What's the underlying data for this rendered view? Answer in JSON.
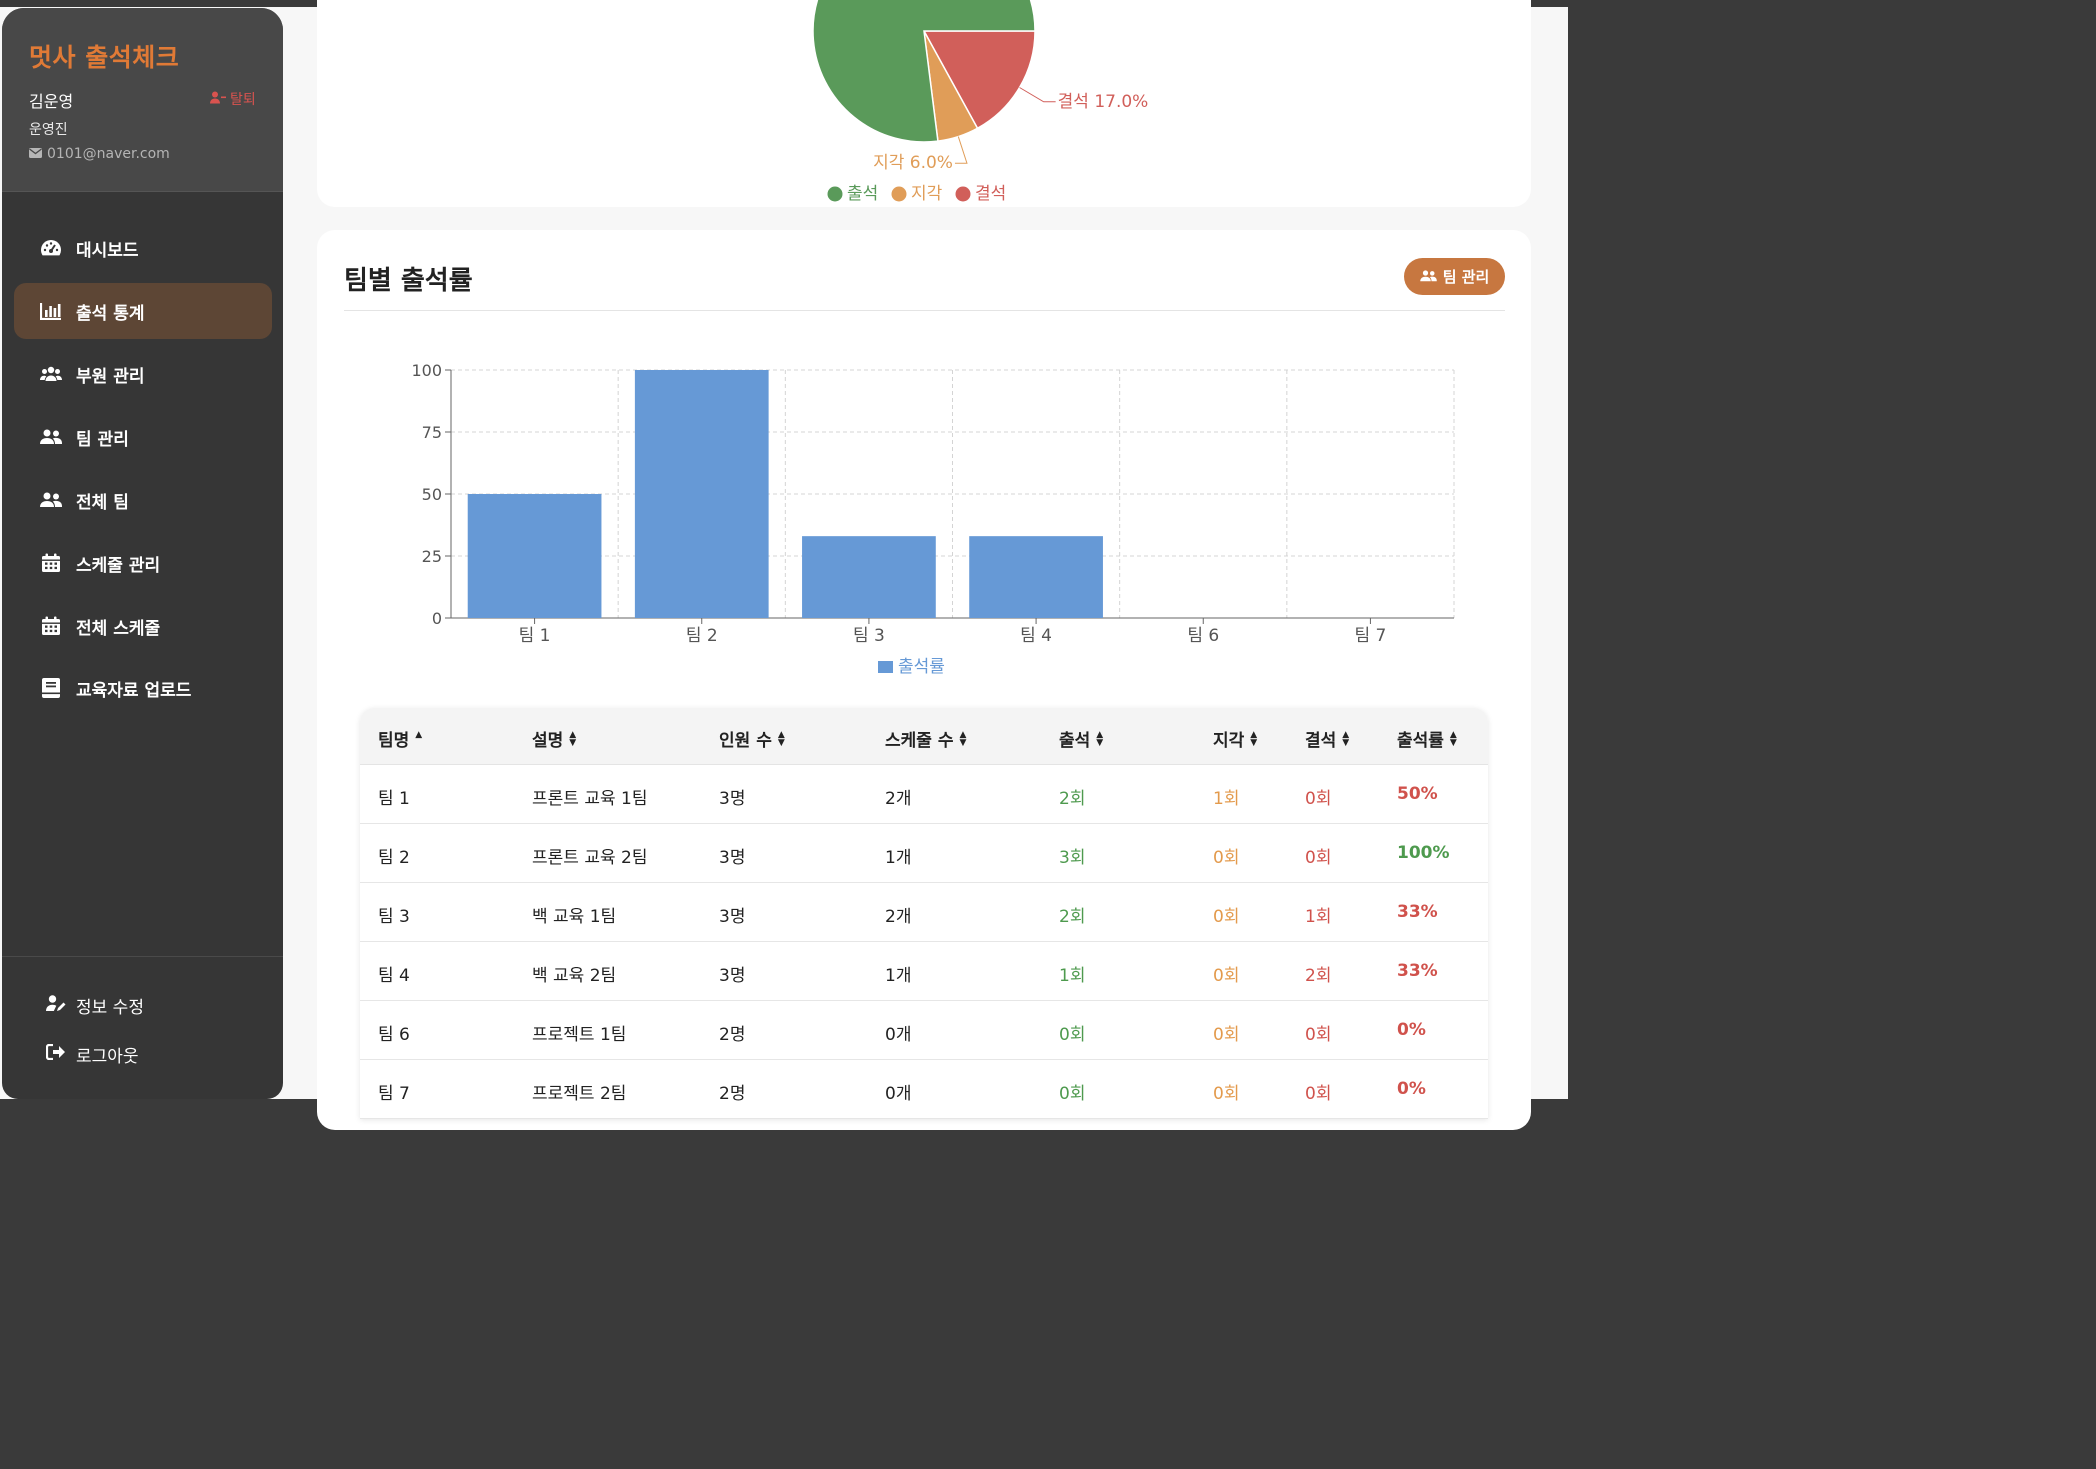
{
  "app": {
    "title": "멋사 출석체크"
  },
  "user": {
    "name": "김운영",
    "role": "운영진",
    "email": "0101@naver.com",
    "withdraw_label": "탈퇴"
  },
  "nav": {
    "items": [
      {
        "label": "대시보드",
        "icon": "dashboard-icon"
      },
      {
        "label": "출석 통계",
        "icon": "chart-bar-icon",
        "active": true
      },
      {
        "label": "부원 관리",
        "icon": "users-icon"
      },
      {
        "label": "팀 관리",
        "icon": "user-group-icon"
      },
      {
        "label": "전체 팀",
        "icon": "user-group-icon"
      },
      {
        "label": "스케줄 관리",
        "icon": "calendar-icon"
      },
      {
        "label": "전체 스케줄",
        "icon": "calendar-icon"
      },
      {
        "label": "교육자료 업로드",
        "icon": "book-icon"
      }
    ],
    "bottom": [
      {
        "label": "정보 수정",
        "icon": "user-edit-icon"
      },
      {
        "label": "로그아웃",
        "icon": "sign-out-icon"
      }
    ]
  },
  "pie": {
    "labels": {
      "late": "지각 6.0%",
      "absent": "결석 17.0%"
    },
    "legend": [
      "출석",
      "지각",
      "결석"
    ]
  },
  "team_section": {
    "title": "팀별 출석률",
    "button_label": "팀 관리"
  },
  "chart_data": [
    {
      "type": "pie",
      "categories": [
        "출석",
        "지각",
        "결석"
      ],
      "values": [
        77.0,
        6.0,
        17.0
      ],
      "colors": [
        "#5a9a5a",
        "#e09d58",
        "#d15f5a"
      ],
      "legend_position": "bottom"
    },
    {
      "type": "bar",
      "categories": [
        "팀 1",
        "팀 2",
        "팀 3",
        "팀 4",
        "팀 6",
        "팀 7"
      ],
      "series": [
        {
          "name": "출석률",
          "values": [
            50,
            100,
            33,
            33,
            0,
            0
          ]
        }
      ],
      "yticks": [
        "0",
        "25",
        "50",
        "75",
        "100"
      ],
      "ylim": [
        0,
        100
      ],
      "grid": true,
      "color": "#6699d6",
      "legend_position": "bottom"
    }
  ],
  "table": {
    "headers": [
      "팀명",
      "설명",
      "인원 수",
      "스케줄 수",
      "출석",
      "지각",
      "결석",
      "출석률"
    ],
    "rows": [
      {
        "name": "팀 1",
        "desc": "프론트 교육 1팀",
        "members": "3명",
        "schedules": "2개",
        "present": "2회",
        "late": "1회",
        "absent": "0회",
        "rate": "50%",
        "rate_color": "red"
      },
      {
        "name": "팀 2",
        "desc": "프론트 교육 2팀",
        "members": "3명",
        "schedules": "1개",
        "present": "3회",
        "late": "0회",
        "absent": "0회",
        "rate": "100%",
        "rate_color": "green"
      },
      {
        "name": "팀 3",
        "desc": "백 교육 1팀",
        "members": "3명",
        "schedules": "2개",
        "present": "2회",
        "late": "0회",
        "absent": "1회",
        "rate": "33%",
        "rate_color": "red"
      },
      {
        "name": "팀 4",
        "desc": "백 교육 2팀",
        "members": "3명",
        "schedules": "1개",
        "present": "1회",
        "late": "0회",
        "absent": "2회",
        "rate": "33%",
        "rate_color": "red"
      },
      {
        "name": "팀 6",
        "desc": "프로젝트 1팀",
        "members": "2명",
        "schedules": "0개",
        "present": "0회",
        "late": "0회",
        "absent": "0회",
        "rate": "0%",
        "rate_color": "red"
      },
      {
        "name": "팀 7",
        "desc": "프로젝트 2팀",
        "members": "2명",
        "schedules": "0개",
        "present": "0회",
        "late": "0회",
        "absent": "0회",
        "rate": "0%",
        "rate_color": "red"
      }
    ]
  }
}
